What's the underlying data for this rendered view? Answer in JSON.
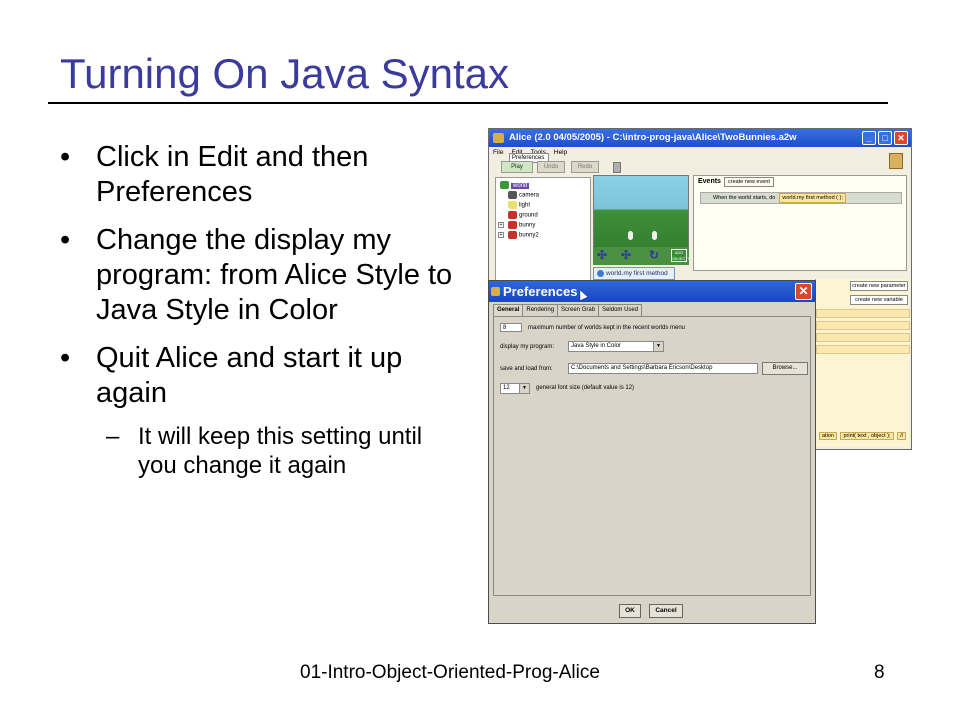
{
  "slide": {
    "title": "Turning On Java Syntax",
    "bullets": [
      "Click in Edit and then Preferences",
      "Change the display my program: from Alice Style to Java Style in Color",
      "Quit Alice and start it up again"
    ],
    "sub_bullet": "It will keep this setting until you change it again",
    "bullet_glyph": "•",
    "dash_glyph": "–",
    "footer": "01-Intro-Object-Oriented-Prog-Alice",
    "page_number": "8",
    "title_color": "#3b3b9c"
  },
  "alice": {
    "title": "Alice (2.0 04/05/2005) - C:\\intro-prog-java\\Alice\\TwoBunnies.a2w",
    "menu": [
      "File",
      "Edit",
      "Tools",
      "Help"
    ],
    "menu_popup": "Preferences",
    "toolbar": {
      "play": "Play",
      "undo": "Undo",
      "redo": "Redo"
    },
    "tree": {
      "world": "world",
      "items": [
        "camera",
        "light",
        "ground",
        "bunny",
        "bunny2"
      ]
    },
    "method_tab": "world.my first method",
    "more_controls": "ADD OBJECTS",
    "events": {
      "title": "Events",
      "create_button": "create new event",
      "row_text": "When the world starts, do",
      "row_method": "world.my first method ( );"
    },
    "editor": {
      "create_parameter": "create new parameter",
      "create_variable": "create new variable",
      "bottom_items": [
        "ation",
        "print( text , object );",
        "//"
      ]
    },
    "window_buttons": {
      "minimize": "_",
      "maximize": "□",
      "close": "✕"
    },
    "titlebar_color": "#1d4fc8"
  },
  "preferences": {
    "title": "Preferences",
    "close_glyph": "✕",
    "tabs": [
      "General",
      "Rendering",
      "Screen Grab",
      "Seldom Used"
    ],
    "recent_worlds": {
      "value": "8",
      "label": "maximum number of worlds kept in the recent worlds menu"
    },
    "display": {
      "label": "display my program:",
      "value": "Java Style in Color"
    },
    "save_load": {
      "label": "save and load from:",
      "value": "C:\\Documents and Settings\\Barbara Ericson\\Desktop",
      "browse": "Browse..."
    },
    "font_size": {
      "value": "12",
      "label": "general font size (default value is 12)"
    },
    "ok": "OK",
    "cancel": "Cancel",
    "caret_glyph": "▼"
  }
}
